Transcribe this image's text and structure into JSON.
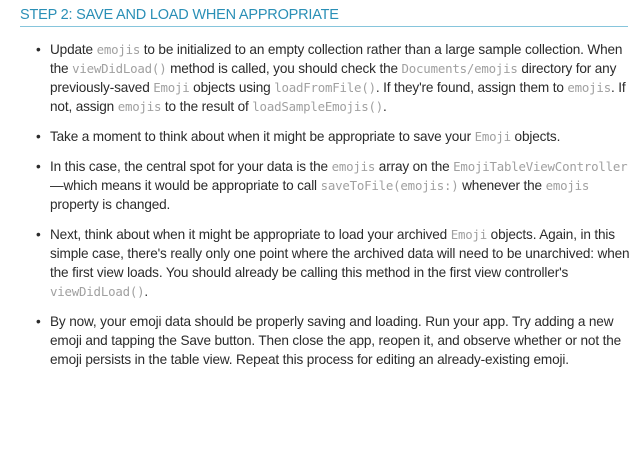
{
  "section": {
    "heading": "STEP 2: SAVE AND LOAD WHEN APPROPRIATE"
  },
  "bullets": [
    {
      "segments": [
        {
          "text": "Update ",
          "code": false
        },
        {
          "text": "emojis",
          "code": true
        },
        {
          "text": " to be initialized to an empty collection rather than a large sample collection. When the ",
          "code": false
        },
        {
          "text": "viewDidLoad()",
          "code": true
        },
        {
          "text": " method is called, you should check the ",
          "code": false
        },
        {
          "text": "Documents/emojis",
          "code": true
        },
        {
          "text": " directory for any previously-saved ",
          "code": false
        },
        {
          "text": "Emoji",
          "code": true
        },
        {
          "text": " objects using ",
          "code": false
        },
        {
          "text": "loadFromFile()",
          "code": true
        },
        {
          "text": ". If they're found, assign them to ",
          "code": false
        },
        {
          "text": "emojis",
          "code": true
        },
        {
          "text": ". If not, assign ",
          "code": false
        },
        {
          "text": "emojis",
          "code": true
        },
        {
          "text": " to the result of ",
          "code": false
        },
        {
          "text": "loadSampleEmojis()",
          "code": true
        },
        {
          "text": ".",
          "code": false
        }
      ]
    },
    {
      "segments": [
        {
          "text": "Take a moment to think about when it might be appropriate to save your ",
          "code": false
        },
        {
          "text": "Emoji",
          "code": true
        },
        {
          "text": " objects.",
          "code": false
        }
      ]
    },
    {
      "segments": [
        {
          "text": "In this case, the central spot for your data is the ",
          "code": false
        },
        {
          "text": "emojis",
          "code": true
        },
        {
          "text": " array on the ",
          "code": false
        },
        {
          "text": "EmojiTableViewController",
          "code": true
        },
        {
          "text": "—which means it would be appropriate to call ",
          "code": false
        },
        {
          "text": "saveToFile(emojis:)",
          "code": true
        },
        {
          "text": " whenever the ",
          "code": false
        },
        {
          "text": "emojis",
          "code": true
        },
        {
          "text": " property is changed.",
          "code": false
        }
      ]
    },
    {
      "segments": [
        {
          "text": "Next, think about when it might be appropriate to load your archived ",
          "code": false
        },
        {
          "text": "Emoji",
          "code": true
        },
        {
          "text": " objects. Again, in this simple case, there's really only one point where the archived data will need to be unarchived: when the first view loads. You should already be calling this method in the first view controller's ",
          "code": false
        },
        {
          "text": "viewDidLoad()",
          "code": true
        },
        {
          "text": ".",
          "code": false
        }
      ]
    },
    {
      "segments": [
        {
          "text": "By now, your emoji data should be properly saving and loading. Run your app. Try adding a new emoji and tapping the Save button. Then close the app, reopen it, and observe whether or not the emoji persists in the table view. Repeat this process for editing an already-existing emoji.",
          "code": false
        }
      ]
    }
  ]
}
